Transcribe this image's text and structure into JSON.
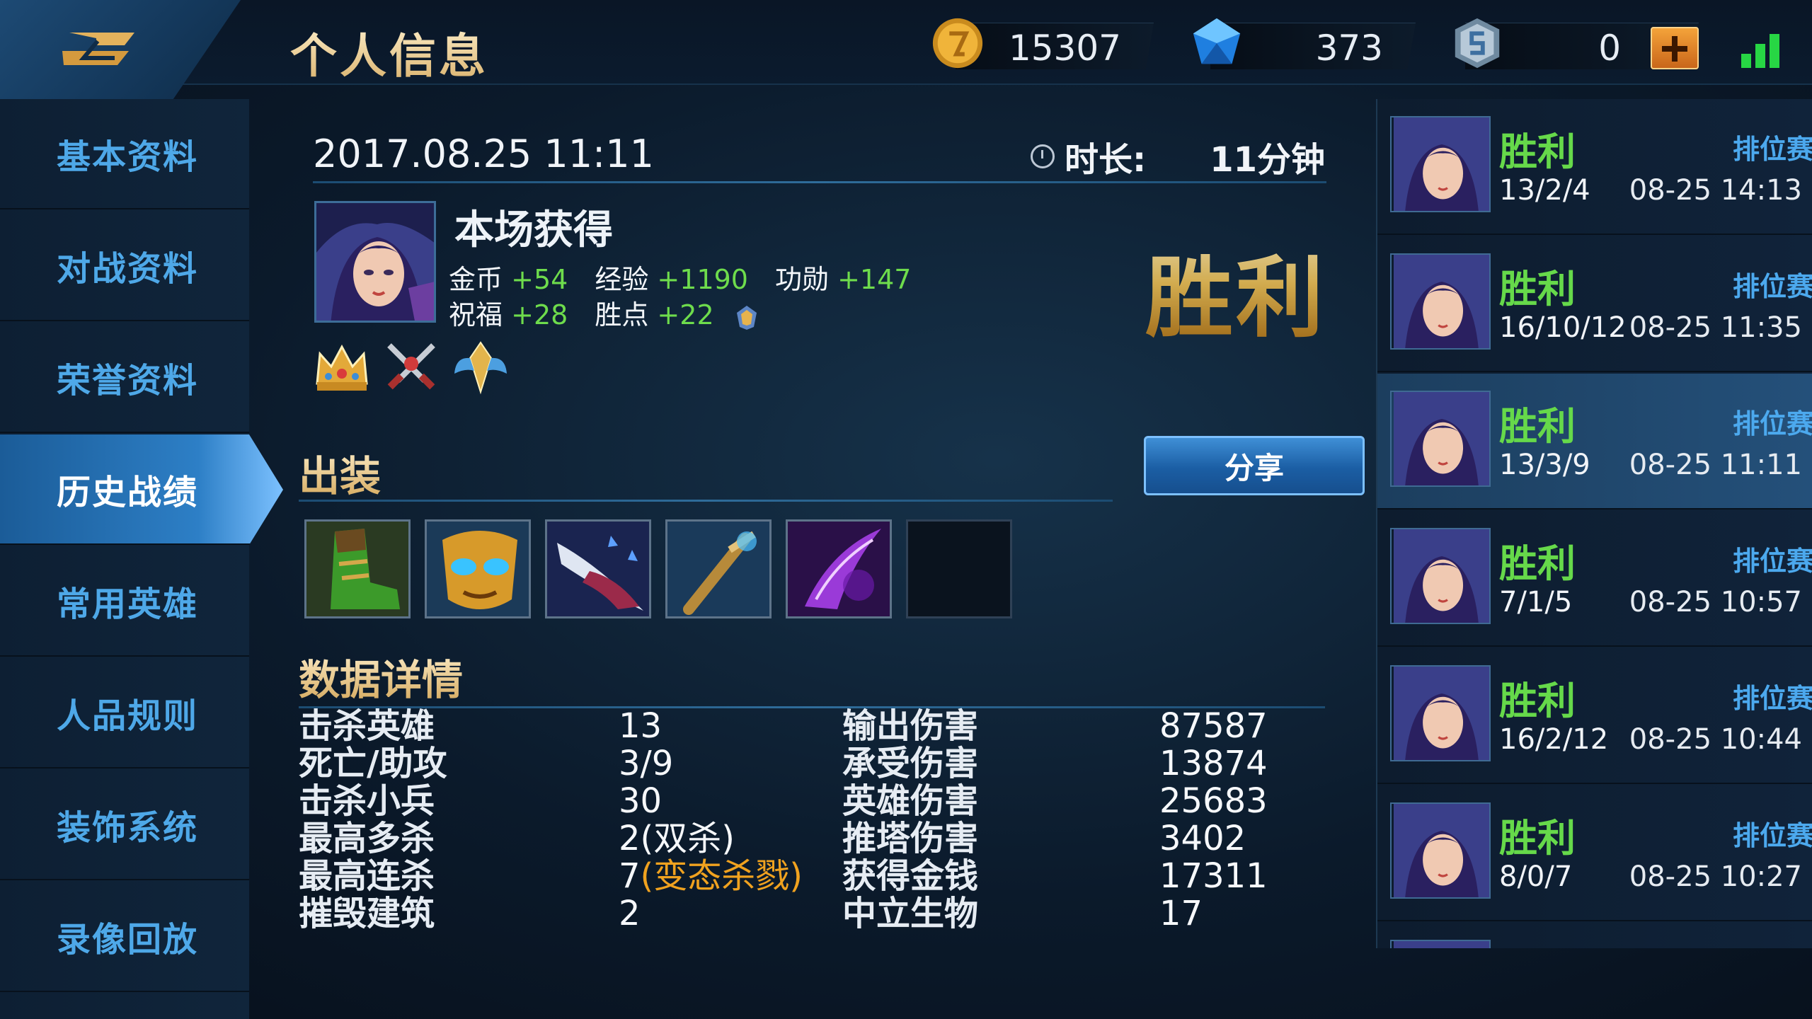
{
  "header": {
    "title": "个人信息",
    "currencies": [
      {
        "name": "gold",
        "value": "15307",
        "icon": "gold-coin-icon"
      },
      {
        "name": "diamond",
        "value": "373",
        "icon": "diamond-icon"
      },
      {
        "name": "token",
        "value": "0",
        "icon": "token-icon"
      }
    ],
    "colors": {
      "accent_gold": "#e8c987",
      "nav_blue": "#4ea8e8",
      "win_green": "#66d94a"
    }
  },
  "sidebar": {
    "items": [
      {
        "label": "基本资料"
      },
      {
        "label": "对战资料"
      },
      {
        "label": "荣誉资料"
      },
      {
        "label": "历史战绩",
        "active": true
      },
      {
        "label": "常用英雄"
      },
      {
        "label": "人品规则"
      },
      {
        "label": "装饰系统"
      },
      {
        "label": "录像回放"
      }
    ]
  },
  "match": {
    "date": "2017.08.25 11:11",
    "duration_label": "时长:",
    "duration_value": "11分钟",
    "rewards_title": "本场获得",
    "rewards": {
      "gold_label": "金币",
      "gold_value": "+54",
      "exp_label": "经验",
      "exp_value": "+1190",
      "merit_label": "功勋",
      "merit_value": "+147",
      "bless_label": "祝福",
      "bless_value": "+28",
      "win_points_label": "胜点",
      "win_points_value": "+22"
    },
    "result": "胜利",
    "equipment_title": "出装",
    "share_label": "分享",
    "stats_title": "数据详情",
    "stats_left": [
      {
        "label": "击杀英雄",
        "value": "13"
      },
      {
        "label": "死亡/助攻",
        "value": "3/9"
      },
      {
        "label": "击杀小兵",
        "value": "30"
      },
      {
        "label": "最高多杀",
        "value": "2(双杀)"
      },
      {
        "label": "最高连杀",
        "value": "7",
        "extra": "(变态杀戮)"
      },
      {
        "label": "摧毁建筑",
        "value": "2"
      }
    ],
    "stats_right": [
      {
        "label": "输出伤害",
        "value": "87587"
      },
      {
        "label": "承受伤害",
        "value": "13874"
      },
      {
        "label": "英雄伤害",
        "value": "25683"
      },
      {
        "label": "推塔伤害",
        "value": "3402"
      },
      {
        "label": "获得金钱",
        "value": "17311"
      },
      {
        "label": "中立生物",
        "value": "17"
      }
    ]
  },
  "history": [
    {
      "result": "胜利",
      "mode": "排位赛",
      "kda": "13/2/4",
      "time": "08-25 14:13"
    },
    {
      "result": "胜利",
      "mode": "排位赛",
      "kda": "16/10/12",
      "time": "08-25 11:35"
    },
    {
      "result": "胜利",
      "mode": "排位赛",
      "kda": "13/3/9",
      "time": "08-25 11:11",
      "selected": true
    },
    {
      "result": "胜利",
      "mode": "排位赛",
      "kda": "7/1/5",
      "time": "08-25 10:57"
    },
    {
      "result": "胜利",
      "mode": "排位赛",
      "kda": "16/2/12",
      "time": "08-25 10:44"
    },
    {
      "result": "胜利",
      "mode": "排位赛",
      "kda": "8/0/7",
      "time": "08-25 10:27"
    }
  ]
}
